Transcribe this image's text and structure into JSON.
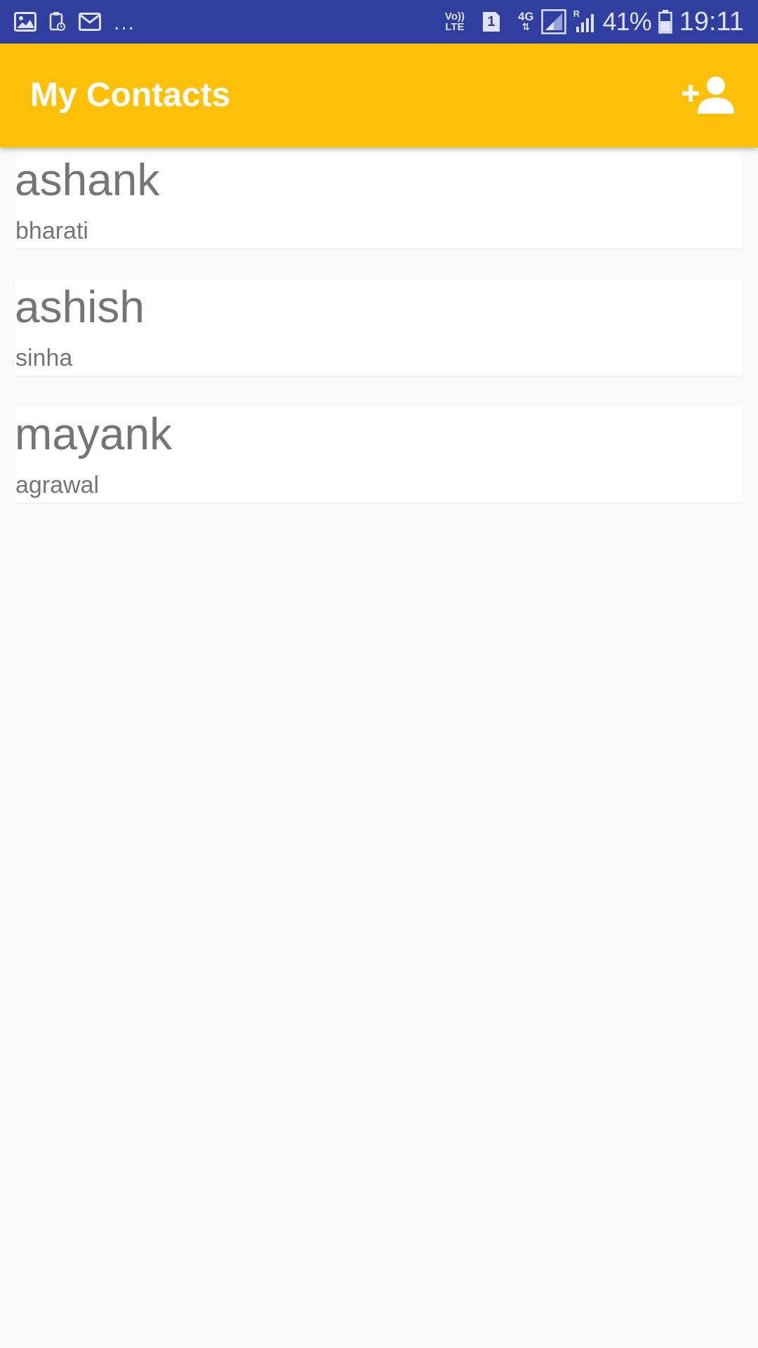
{
  "status_bar": {
    "left_icons": [
      "image-icon",
      "clipboard-sync-icon",
      "mail-icon"
    ],
    "more_indicator": "...",
    "volte_top": "Vo))",
    "volte_bottom": "LTE",
    "sim_slot": "1",
    "network_type": "4G",
    "roaming": "R",
    "battery_percent": "41%",
    "time": "19:11",
    "background_color": "#303F9F"
  },
  "app_bar": {
    "title": "My Contacts",
    "action_icon": "add-person-icon",
    "background_color": "#FFC107"
  },
  "contacts": [
    {
      "first_name": "ashank",
      "last_name": "bharati"
    },
    {
      "first_name": "ashish",
      "last_name": "sinha"
    },
    {
      "first_name": "mayank",
      "last_name": "agrawal"
    }
  ]
}
